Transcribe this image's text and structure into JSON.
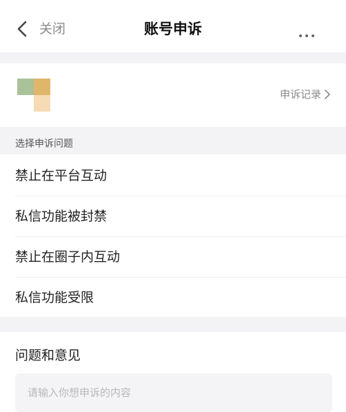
{
  "nav": {
    "close_label": "关闭",
    "title": "账号申诉",
    "back_icon": "chevron-left-icon",
    "more_icon": "more-dots-icon"
  },
  "profile": {
    "avatar_colors": [
      "#a9c29a",
      "#e0b66a",
      "#f6dbb4"
    ],
    "records_label": "申诉记录",
    "records_icon": "chevron-right-icon"
  },
  "section": {
    "label": "选择申诉问题"
  },
  "issues": [
    {
      "label": "禁止在平台互动"
    },
    {
      "label": "私信功能被封禁"
    },
    {
      "label": "禁止在圈子内互动"
    },
    {
      "label": "私信功能受限"
    }
  ],
  "feedback": {
    "label": "问题和意见",
    "placeholder": "请输入你想申诉的内容"
  }
}
